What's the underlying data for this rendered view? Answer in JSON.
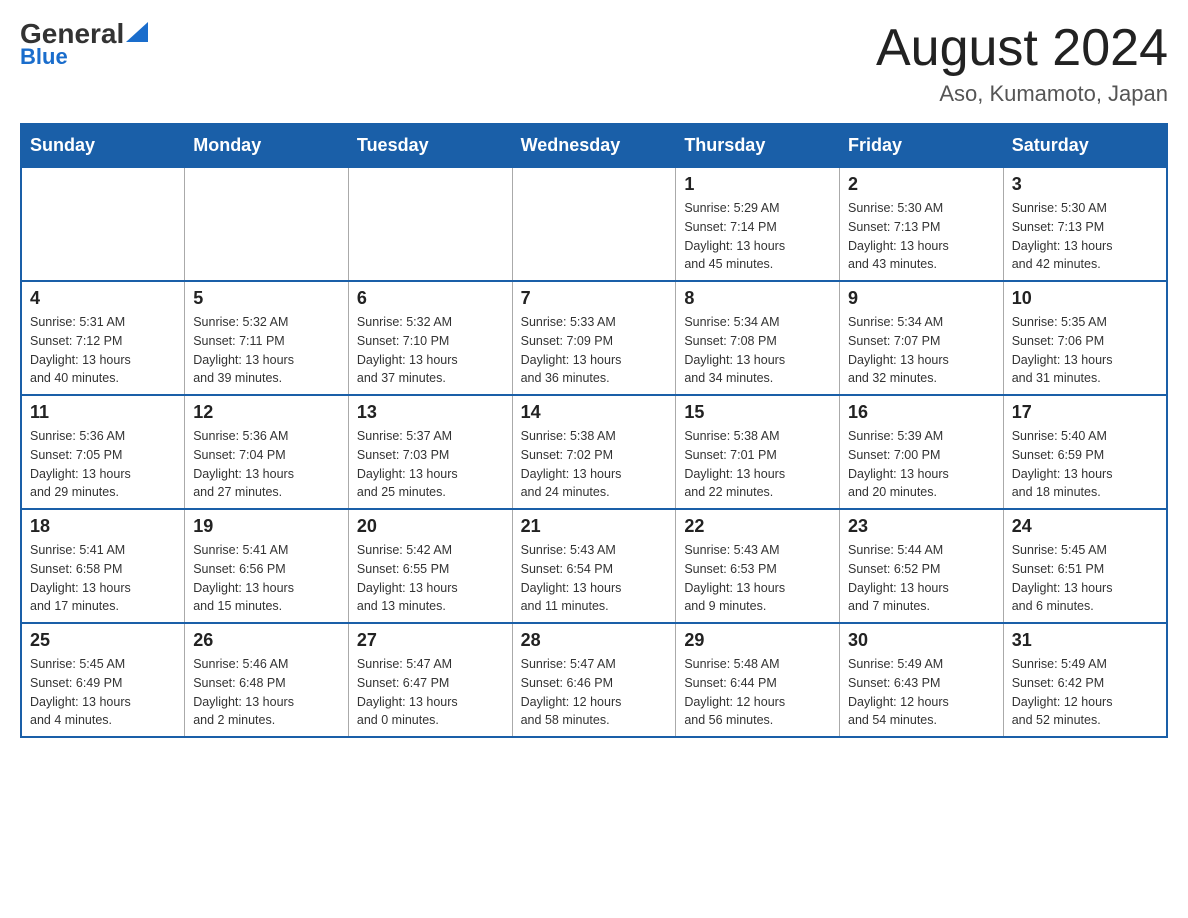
{
  "header": {
    "logo_general": "General",
    "logo_blue": "Blue",
    "month_title": "August 2024",
    "location": "Aso, Kumamoto, Japan"
  },
  "weekdays": [
    "Sunday",
    "Monday",
    "Tuesday",
    "Wednesday",
    "Thursday",
    "Friday",
    "Saturday"
  ],
  "weeks": [
    [
      {
        "day": "",
        "info": ""
      },
      {
        "day": "",
        "info": ""
      },
      {
        "day": "",
        "info": ""
      },
      {
        "day": "",
        "info": ""
      },
      {
        "day": "1",
        "info": "Sunrise: 5:29 AM\nSunset: 7:14 PM\nDaylight: 13 hours\nand 45 minutes."
      },
      {
        "day": "2",
        "info": "Sunrise: 5:30 AM\nSunset: 7:13 PM\nDaylight: 13 hours\nand 43 minutes."
      },
      {
        "day": "3",
        "info": "Sunrise: 5:30 AM\nSunset: 7:13 PM\nDaylight: 13 hours\nand 42 minutes."
      }
    ],
    [
      {
        "day": "4",
        "info": "Sunrise: 5:31 AM\nSunset: 7:12 PM\nDaylight: 13 hours\nand 40 minutes."
      },
      {
        "day": "5",
        "info": "Sunrise: 5:32 AM\nSunset: 7:11 PM\nDaylight: 13 hours\nand 39 minutes."
      },
      {
        "day": "6",
        "info": "Sunrise: 5:32 AM\nSunset: 7:10 PM\nDaylight: 13 hours\nand 37 minutes."
      },
      {
        "day": "7",
        "info": "Sunrise: 5:33 AM\nSunset: 7:09 PM\nDaylight: 13 hours\nand 36 minutes."
      },
      {
        "day": "8",
        "info": "Sunrise: 5:34 AM\nSunset: 7:08 PM\nDaylight: 13 hours\nand 34 minutes."
      },
      {
        "day": "9",
        "info": "Sunrise: 5:34 AM\nSunset: 7:07 PM\nDaylight: 13 hours\nand 32 minutes."
      },
      {
        "day": "10",
        "info": "Sunrise: 5:35 AM\nSunset: 7:06 PM\nDaylight: 13 hours\nand 31 minutes."
      }
    ],
    [
      {
        "day": "11",
        "info": "Sunrise: 5:36 AM\nSunset: 7:05 PM\nDaylight: 13 hours\nand 29 minutes."
      },
      {
        "day": "12",
        "info": "Sunrise: 5:36 AM\nSunset: 7:04 PM\nDaylight: 13 hours\nand 27 minutes."
      },
      {
        "day": "13",
        "info": "Sunrise: 5:37 AM\nSunset: 7:03 PM\nDaylight: 13 hours\nand 25 minutes."
      },
      {
        "day": "14",
        "info": "Sunrise: 5:38 AM\nSunset: 7:02 PM\nDaylight: 13 hours\nand 24 minutes."
      },
      {
        "day": "15",
        "info": "Sunrise: 5:38 AM\nSunset: 7:01 PM\nDaylight: 13 hours\nand 22 minutes."
      },
      {
        "day": "16",
        "info": "Sunrise: 5:39 AM\nSunset: 7:00 PM\nDaylight: 13 hours\nand 20 minutes."
      },
      {
        "day": "17",
        "info": "Sunrise: 5:40 AM\nSunset: 6:59 PM\nDaylight: 13 hours\nand 18 minutes."
      }
    ],
    [
      {
        "day": "18",
        "info": "Sunrise: 5:41 AM\nSunset: 6:58 PM\nDaylight: 13 hours\nand 17 minutes."
      },
      {
        "day": "19",
        "info": "Sunrise: 5:41 AM\nSunset: 6:56 PM\nDaylight: 13 hours\nand 15 minutes."
      },
      {
        "day": "20",
        "info": "Sunrise: 5:42 AM\nSunset: 6:55 PM\nDaylight: 13 hours\nand 13 minutes."
      },
      {
        "day": "21",
        "info": "Sunrise: 5:43 AM\nSunset: 6:54 PM\nDaylight: 13 hours\nand 11 minutes."
      },
      {
        "day": "22",
        "info": "Sunrise: 5:43 AM\nSunset: 6:53 PM\nDaylight: 13 hours\nand 9 minutes."
      },
      {
        "day": "23",
        "info": "Sunrise: 5:44 AM\nSunset: 6:52 PM\nDaylight: 13 hours\nand 7 minutes."
      },
      {
        "day": "24",
        "info": "Sunrise: 5:45 AM\nSunset: 6:51 PM\nDaylight: 13 hours\nand 6 minutes."
      }
    ],
    [
      {
        "day": "25",
        "info": "Sunrise: 5:45 AM\nSunset: 6:49 PM\nDaylight: 13 hours\nand 4 minutes."
      },
      {
        "day": "26",
        "info": "Sunrise: 5:46 AM\nSunset: 6:48 PM\nDaylight: 13 hours\nand 2 minutes."
      },
      {
        "day": "27",
        "info": "Sunrise: 5:47 AM\nSunset: 6:47 PM\nDaylight: 13 hours\nand 0 minutes."
      },
      {
        "day": "28",
        "info": "Sunrise: 5:47 AM\nSunset: 6:46 PM\nDaylight: 12 hours\nand 58 minutes."
      },
      {
        "day": "29",
        "info": "Sunrise: 5:48 AM\nSunset: 6:44 PM\nDaylight: 12 hours\nand 56 minutes."
      },
      {
        "day": "30",
        "info": "Sunrise: 5:49 AM\nSunset: 6:43 PM\nDaylight: 12 hours\nand 54 minutes."
      },
      {
        "day": "31",
        "info": "Sunrise: 5:49 AM\nSunset: 6:42 PM\nDaylight: 12 hours\nand 52 minutes."
      }
    ]
  ]
}
